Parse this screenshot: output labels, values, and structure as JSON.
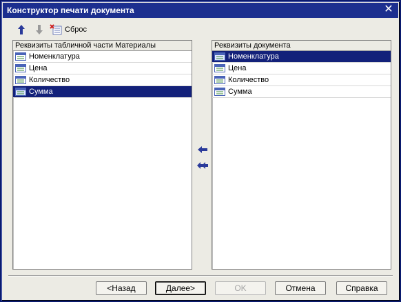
{
  "window": {
    "title": "Конструктор печати документа"
  },
  "toolbar": {
    "reset_label": "Сброс"
  },
  "left_panel": {
    "header": "Реквизиты табличной части Материалы",
    "items": [
      "Номенклатура",
      "Цена",
      "Количество",
      "Сумма"
    ],
    "selected_index": 3
  },
  "right_panel": {
    "header": "Реквизиты документа",
    "items": [
      "Номенклатура",
      "Цена",
      "Количество",
      "Сумма"
    ],
    "selected_index": 0
  },
  "buttons": {
    "back": "<Назад",
    "next": "Далее>",
    "ok": "OK",
    "cancel": "Отмена",
    "help": "Справка"
  },
  "colors": {
    "title_bar": "#1c2f8f",
    "selection": "#13217a",
    "arrow": "#2a3a9a"
  }
}
